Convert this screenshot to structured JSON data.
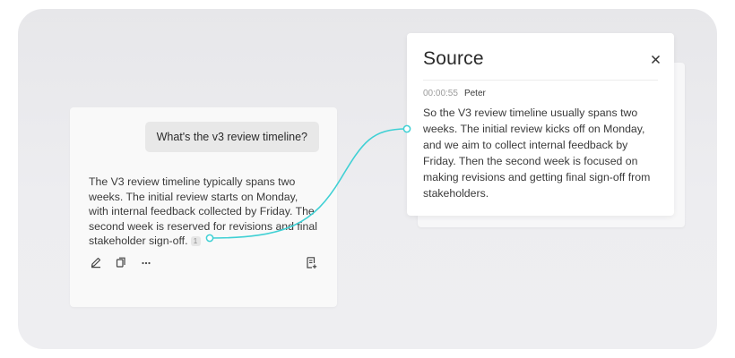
{
  "chat": {
    "question": "What's the v3 review timeline?",
    "answer": "The V3 review timeline typically spans two weeks. The initial review starts on Monday, with internal feedback collected by Friday. The second week is reserved for revisions and final stakeholder sign-off.",
    "citation_number": "1",
    "actions": {
      "edit_icon": "pencil-icon",
      "copy_icon": "copy-icon",
      "more_icon": "more-icon",
      "note_icon": "add-note-icon",
      "more_label": "···"
    }
  },
  "source": {
    "title": "Source",
    "close_icon": "close-icon",
    "timestamp": "00:00:55",
    "speaker": "Peter",
    "text": "So the V3 review timeline usually spans two weeks. The initial review kicks off on Monday, and we aim to collect internal feedback by Friday. Then the second week is focused on making revisions and getting final sign-off from stakeholders."
  },
  "colors": {
    "connector": "#3fd0d4"
  }
}
